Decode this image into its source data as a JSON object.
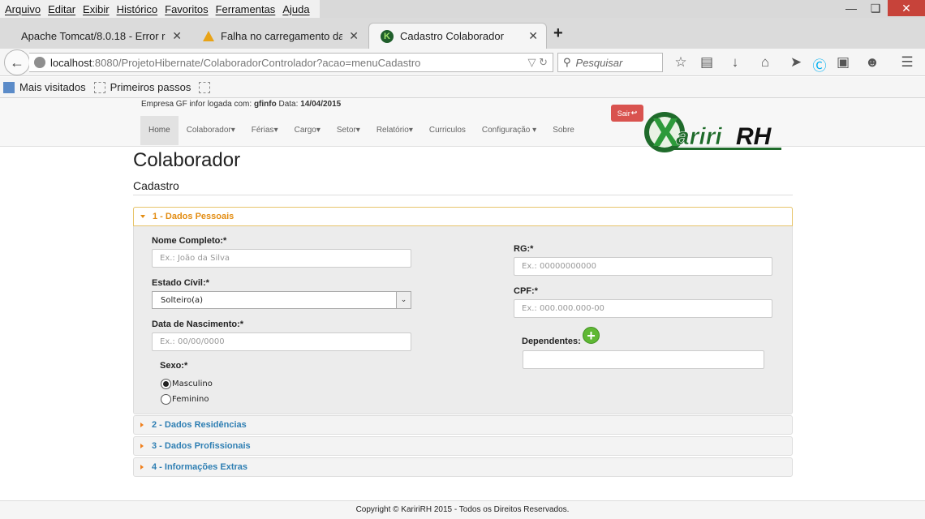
{
  "browser": {
    "menu": [
      "Arquivo",
      "Editar",
      "Exibir",
      "Histórico",
      "Favoritos",
      "Ferramentas",
      "Ajuda"
    ],
    "tabs": [
      {
        "title": "Apache Tomcat/8.0.18 - Error r..."
      },
      {
        "title": "Falha no carregamento da ..."
      },
      {
        "title": "Cadastro Colaborador"
      }
    ],
    "url_host": "localhost",
    "url_path": ":8080/ProjetoHibernate/ColaboradorControlador?acao=menuCadastro",
    "search_placeholder": "Pesquisar",
    "bookmarks": [
      "Mais visitados",
      "Primeiros passos"
    ]
  },
  "header": {
    "company_prefix": "Empresa GF infor logada com: ",
    "user": "gfinfo",
    "date_prefix": " Data: ",
    "date": "14/04/2015",
    "logout_label": "Sair",
    "logo_text": "KaririRH",
    "nav": [
      "Home",
      "Colaborador",
      "Férias",
      "Cargo",
      "Setor",
      "Relatório",
      "Curriculos",
      "Configuração",
      "Sobre"
    ]
  },
  "main": {
    "title": "Colaborador",
    "subtitle": "Cadastro",
    "sections": [
      {
        "label": "1 - Dados Pessoais"
      },
      {
        "label": "2 - Dados Residências"
      },
      {
        "label": "3 - Dados Profissionais"
      },
      {
        "label": "4 - Informações Extras"
      }
    ],
    "form": {
      "nome_label": "Nome Completo:*",
      "nome_placeholder": "Ex.: João da Silva",
      "estado_label": "Estado Cívil:*",
      "estado_value": "Solteiro(a)",
      "nascimento_label": "Data de Nascimento:*",
      "nascimento_placeholder": "Ex.: 00/00/0000",
      "sexo_label": "Sexo:*",
      "sexo_options": [
        "Masculino",
        "Feminino"
      ],
      "sexo_selected": "Masculino",
      "rg_label": "RG:*",
      "rg_placeholder": "Ex.: 00000000000",
      "cpf_label": "CPF:*",
      "cpf_placeholder": "Ex.: 000.000.000-00",
      "dependentes_label": "Dependentes:",
      "dependentes_value": ""
    }
  },
  "footer": {
    "text": "Copyright © KaririRH 2015 - Todos os Direitos Reservados."
  },
  "colors": {
    "accent_orange": "#e38d13",
    "link_blue": "#2f7fb3",
    "logout_red": "#d9534f",
    "logo_green": "#1f6b2b"
  }
}
